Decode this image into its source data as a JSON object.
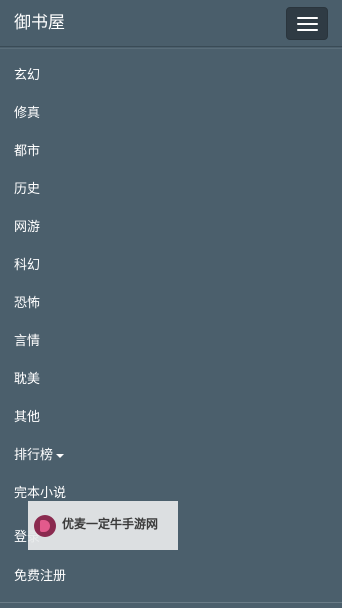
{
  "navbar": {
    "brand": "御书屋",
    "toggle_icon": "hamburger-icon"
  },
  "menu": {
    "items": [
      {
        "label": "玄幻"
      },
      {
        "label": "修真"
      },
      {
        "label": "都市"
      },
      {
        "label": "历史"
      },
      {
        "label": "网游"
      },
      {
        "label": "科幻"
      },
      {
        "label": "恐怖"
      },
      {
        "label": "言情"
      },
      {
        "label": "耽美"
      },
      {
        "label": "其他"
      },
      {
        "label": "排行榜"
      },
      {
        "label": "完本小说"
      },
      {
        "label": "登录"
      },
      {
        "label": "免费注册"
      }
    ]
  },
  "watermark": {
    "text": "优麦一定牛手游网"
  }
}
